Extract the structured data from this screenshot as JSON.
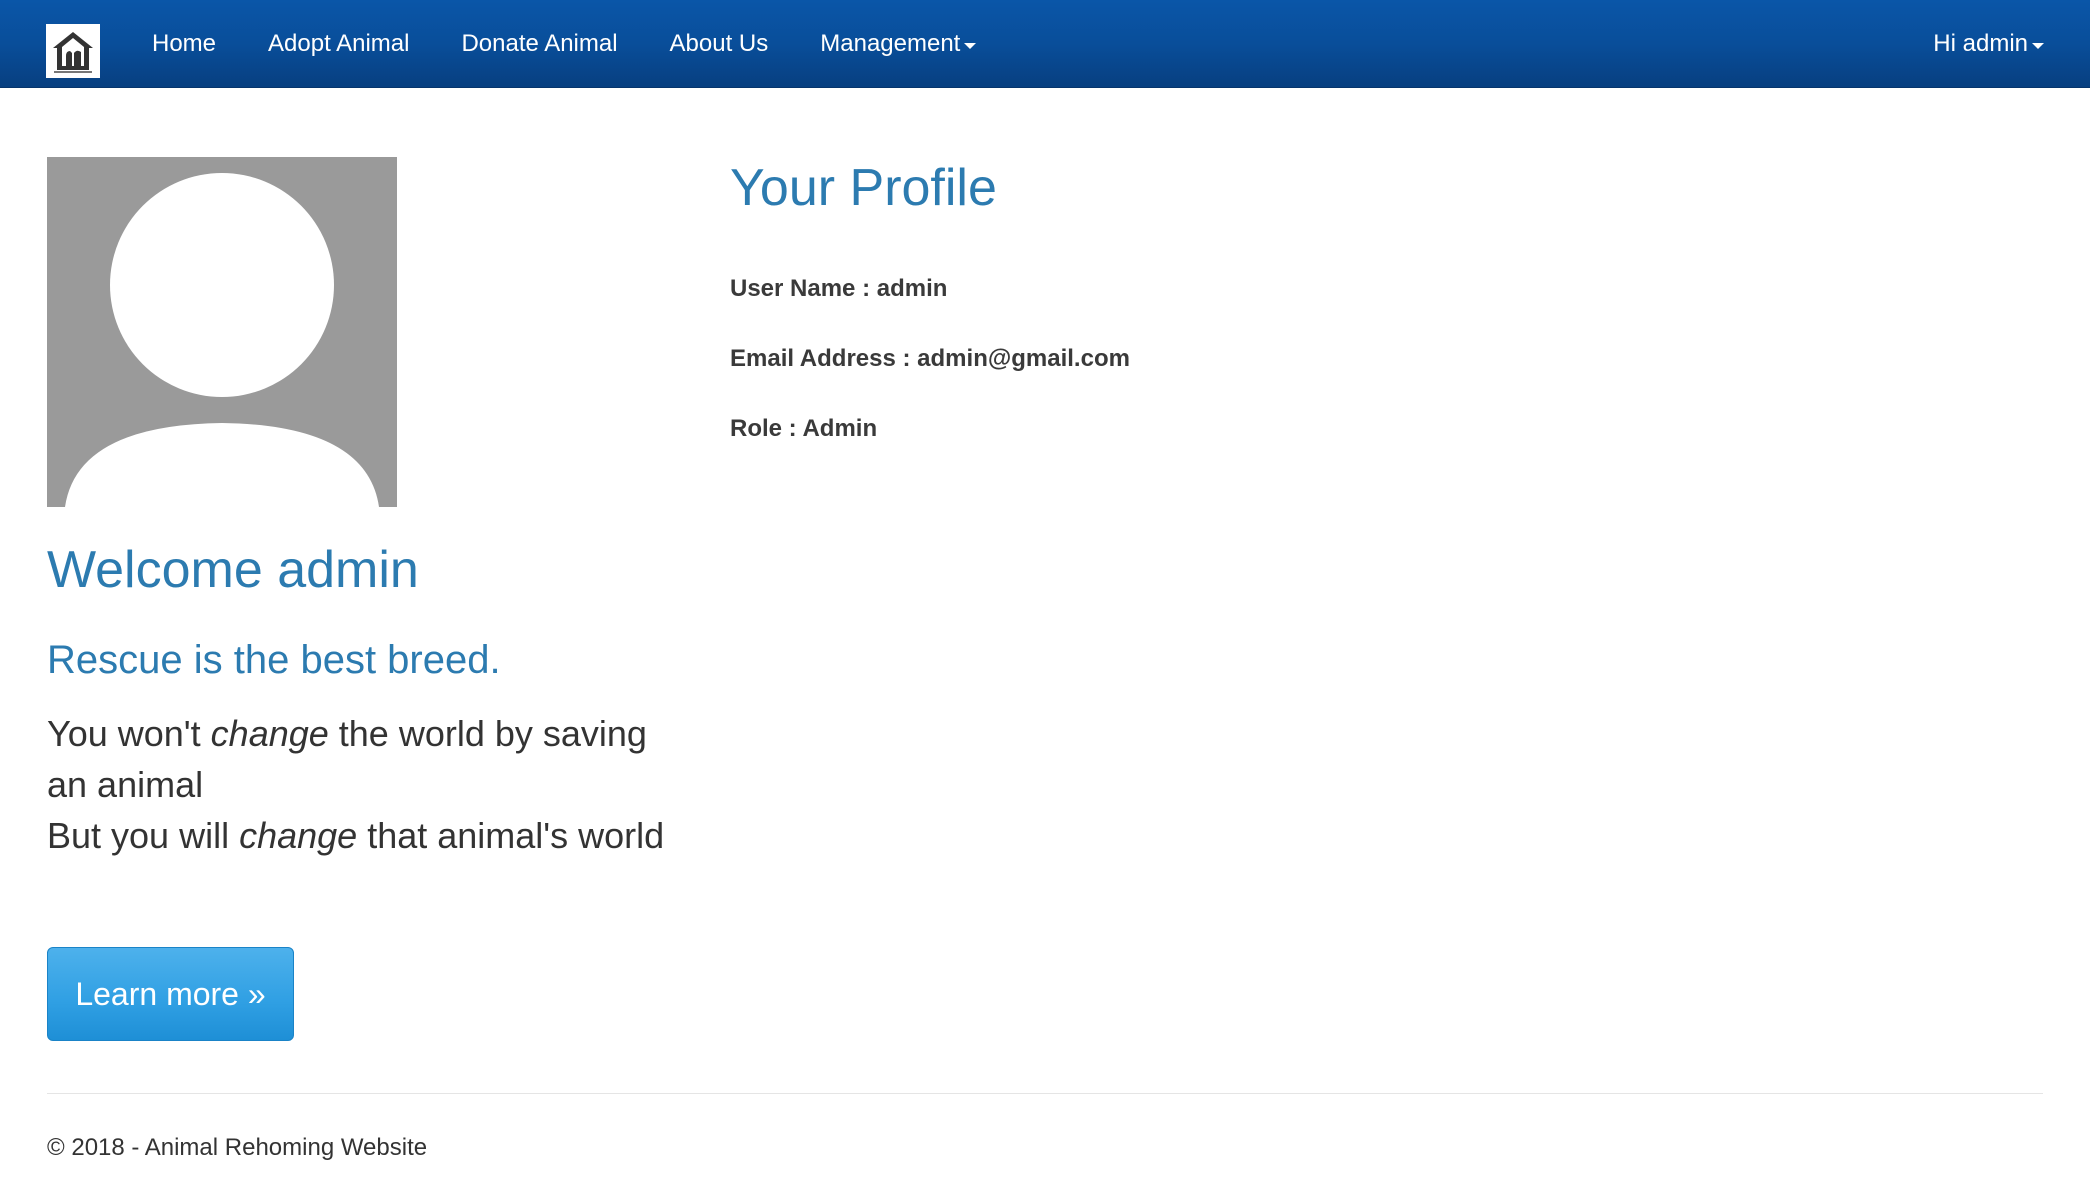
{
  "navbar": {
    "brand_icon": "shelter-logo-icon",
    "links": [
      "Home",
      "Adopt Animal",
      "Donate Animal",
      "About Us",
      "Management"
    ],
    "user_menu": "Hi admin",
    "background_color": "#094e9a"
  },
  "left": {
    "avatar_icon": "default-avatar-icon",
    "welcome": "Welcome admin",
    "tagline": "Rescue is the best breed.",
    "quote": {
      "line1_a": "You won't ",
      "line1_em": "change",
      "line1_b": " the world by saving an animal",
      "line2_a": "But you will ",
      "line2_em": "change",
      "line2_b": " that animal's world"
    },
    "learn_more": "Learn more »"
  },
  "profile": {
    "title": "Your Profile",
    "user_name": "User Name : admin",
    "email": "Email Address : admin@gmail.com",
    "role": "Role : Admin"
  },
  "footer": {
    "copyright": "© 2018 - Animal Rehoming Website"
  },
  "colors": {
    "accent": "#2c7bb0",
    "button": "#2f9fe3"
  }
}
